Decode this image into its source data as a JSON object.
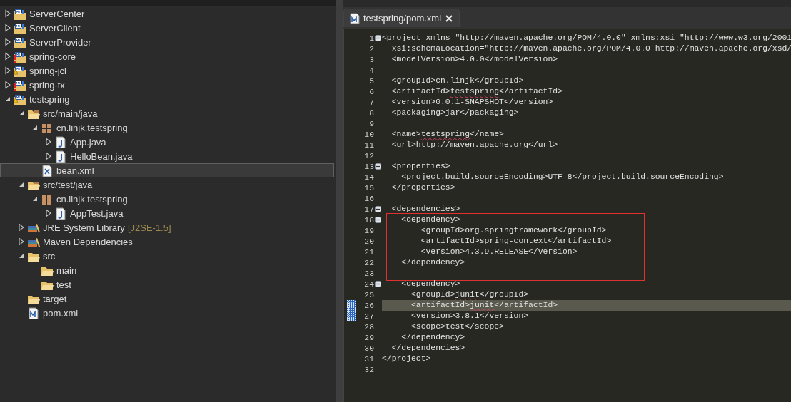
{
  "explorer": {
    "items": [
      {
        "label": "ServerCenter",
        "kind": "project",
        "error": false,
        "warning": false,
        "expandable": true,
        "expanded": false,
        "selected": false
      },
      {
        "label": "ServerClient",
        "kind": "project",
        "error": false,
        "warning": false,
        "expandable": true,
        "expanded": false,
        "selected": false
      },
      {
        "label": "ServerProvider",
        "kind": "project",
        "error": false,
        "warning": false,
        "expandable": true,
        "expanded": false,
        "selected": false
      },
      {
        "label": "spring-core",
        "kind": "project",
        "error": true,
        "warning": false,
        "expandable": true,
        "expanded": false,
        "selected": false
      },
      {
        "label": "spring-jcl",
        "kind": "project",
        "error": false,
        "warning": true,
        "expandable": true,
        "expanded": false,
        "selected": false
      },
      {
        "label": "spring-tx",
        "kind": "project",
        "error": true,
        "warning": false,
        "expandable": true,
        "expanded": false,
        "selected": false
      },
      {
        "label": "testspring",
        "kind": "project",
        "error": false,
        "warning": true,
        "expandable": true,
        "expanded": true,
        "selected": false,
        "children": [
          {
            "label": "src/main/java",
            "kind": "sourcefolder",
            "expandable": true,
            "expanded": true,
            "selected": false,
            "children": [
              {
                "label": "cn.linjk.testspring",
                "kind": "package",
                "expandable": true,
                "expanded": true,
                "selected": false,
                "children": [
                  {
                    "label": "App.java",
                    "kind": "java",
                    "expandable": true,
                    "expanded": false,
                    "selected": false
                  },
                  {
                    "label": "HelloBean.java",
                    "kind": "java",
                    "expandable": true,
                    "expanded": false,
                    "selected": false
                  }
                ]
              },
              {
                "label": "bean.xml",
                "kind": "xml",
                "expandable": false,
                "selected": true
              }
            ]
          },
          {
            "label": "src/test/java",
            "kind": "sourcefolder",
            "expandable": true,
            "expanded": true,
            "selected": false,
            "children": [
              {
                "label": "cn.linjk.testspring",
                "kind": "package",
                "expandable": true,
                "expanded": true,
                "selected": false,
                "children": [
                  {
                    "label": "AppTest.java",
                    "kind": "java",
                    "expandable": true,
                    "expanded": false,
                    "selected": false
                  }
                ]
              }
            ]
          },
          {
            "label": "JRE System Library",
            "suffix": "[J2SE-1.5]",
            "kind": "library",
            "expandable": true,
            "expanded": false,
            "selected": false
          },
          {
            "label": "Maven Dependencies",
            "kind": "library",
            "expandable": true,
            "expanded": false,
            "selected": false
          },
          {
            "label": "src",
            "kind": "folder",
            "expandable": true,
            "expanded": true,
            "selected": false,
            "children": [
              {
                "label": "main",
                "kind": "folder",
                "expandable": false,
                "selected": false
              },
              {
                "label": "test",
                "kind": "folder",
                "expandable": false,
                "selected": false
              }
            ]
          },
          {
            "label": "target",
            "kind": "folder",
            "expandable": false,
            "selected": false
          },
          {
            "label": "pom.xml",
            "kind": "pom",
            "expandable": false,
            "selected": false
          }
        ]
      }
    ]
  },
  "editor": {
    "tabs": [
      {
        "label": "testspring/pom.xml",
        "selected": true
      }
    ],
    "lines": [
      {
        "number": "1",
        "text": "<project xmlns=\"http://maven.apache.org/POM/4.0.0\" xmlns:xsi=\"http://www.w3.org/2001",
        "fold": true,
        "current": false,
        "changed": false,
        "boxed": false
      },
      {
        "number": "2",
        "text": "  xsi:schemaLocation=\"http://maven.apache.org/POM/4.0.0 http://maven.apache.org/xsd/",
        "fold": false,
        "current": false,
        "changed": false,
        "boxed": false
      },
      {
        "number": "3",
        "text": "  <modelVersion>4.0.0</modelVersion>",
        "fold": false,
        "current": false,
        "changed": false,
        "boxed": false
      },
      {
        "number": "4",
        "fold": false,
        "current": false,
        "changed": false,
        "boxed": false
      },
      {
        "number": "5",
        "text": "  <groupId>cn.linjk</groupId>",
        "fold": false,
        "current": false,
        "changed": false,
        "boxed": false
      },
      {
        "number": "6",
        "segments": [
          {
            "text": "  <artifactId>",
            "misspelled": false
          },
          {
            "text": "testspring",
            "misspelled": true
          },
          {
            "text": "</artifactId>",
            "misspelled": false
          }
        ],
        "fold": false,
        "current": false,
        "changed": false,
        "boxed": false
      },
      {
        "number": "7",
        "text": "  <version>0.0.1-SNAPSHOT</version>",
        "fold": false,
        "current": false,
        "changed": false,
        "boxed": false
      },
      {
        "number": "8",
        "text": "  <packaging>jar</packaging>",
        "fold": false,
        "current": false,
        "changed": false,
        "boxed": false
      },
      {
        "number": "9",
        "fold": false,
        "current": false,
        "changed": false,
        "boxed": false
      },
      {
        "number": "10",
        "segments": [
          {
            "text": "  <name>",
            "misspelled": false
          },
          {
            "text": "testspring",
            "misspelled": true
          },
          {
            "text": "</name>",
            "misspelled": false
          }
        ],
        "fold": false,
        "current": false,
        "changed": false,
        "boxed": false
      },
      {
        "number": "11",
        "text": "  <url>http://maven.apache.org</url>",
        "fold": false,
        "current": false,
        "changed": false,
        "boxed": false
      },
      {
        "number": "12",
        "fold": false,
        "current": false,
        "changed": false,
        "boxed": false
      },
      {
        "number": "13",
        "text": "  <properties>",
        "fold": true,
        "current": false,
        "changed": false,
        "boxed": false
      },
      {
        "number": "14",
        "text": "    <project.build.sourceEncoding>UTF-8</project.build.sourceEncoding>",
        "fold": false,
        "current": false,
        "changed": false,
        "boxed": false
      },
      {
        "number": "15",
        "text": "  </properties>",
        "fold": false,
        "current": false,
        "changed": false,
        "boxed": false
      },
      {
        "number": "16",
        "fold": false,
        "current": false,
        "changed": false,
        "boxed": false
      },
      {
        "number": "17",
        "text": "  <dependencies>",
        "fold": true,
        "current": false,
        "changed": false,
        "boxed": false
      },
      {
        "number": "18",
        "text": "    <dependency>",
        "fold": true,
        "current": false,
        "changed": false,
        "boxed": true
      },
      {
        "number": "19",
        "text": "        <groupId>org.springframework</groupId>",
        "fold": false,
        "current": false,
        "changed": false,
        "boxed": true
      },
      {
        "number": "20",
        "text": "        <artifactId>spring-context</artifactId>",
        "fold": false,
        "current": false,
        "changed": false,
        "boxed": true
      },
      {
        "number": "21",
        "text": "        <version>4.3.9.RELEASE</version>",
        "fold": false,
        "current": false,
        "changed": false,
        "boxed": true
      },
      {
        "number": "22",
        "text": "    </dependency>",
        "fold": false,
        "current": false,
        "changed": false,
        "boxed": true
      },
      {
        "number": "23",
        "fold": false,
        "current": false,
        "changed": false,
        "boxed": true
      },
      {
        "number": "24",
        "text": "    <dependency>",
        "fold": true,
        "current": false,
        "changed": false,
        "boxed": false
      },
      {
        "number": "25",
        "segments": [
          {
            "text": "      <groupId>",
            "misspelled": false
          },
          {
            "text": "junit",
            "misspelled": true
          },
          {
            "text": "</groupId>",
            "misspelled": false
          }
        ],
        "fold": false,
        "current": false,
        "changed": false,
        "boxed": false
      },
      {
        "number": "26",
        "segments": [
          {
            "text": "      <artifactId>",
            "misspelled": false
          },
          {
            "text": "junit",
            "misspelled": true
          },
          {
            "text": "</artifactId>",
            "misspelled": false
          }
        ],
        "fold": false,
        "current": true,
        "changed": true,
        "boxed": false
      },
      {
        "number": "27",
        "text": "      <version>3.8.1</version>",
        "fold": false,
        "current": false,
        "changed": true,
        "boxed": false
      },
      {
        "number": "28",
        "text": "      <scope>test</scope>",
        "fold": false,
        "current": false,
        "changed": false,
        "boxed": false
      },
      {
        "number": "29",
        "text": "    </dependency>",
        "fold": false,
        "current": false,
        "changed": false,
        "boxed": false
      },
      {
        "number": "30",
        "text": "  </dependencies>",
        "fold": false,
        "current": false,
        "changed": false,
        "boxed": false
      },
      {
        "number": "31",
        "text": "</project>",
        "fold": false,
        "current": false,
        "changed": false,
        "boxed": false
      },
      {
        "number": "32",
        "fold": false,
        "current": false,
        "changed": false,
        "boxed": false
      }
    ]
  }
}
